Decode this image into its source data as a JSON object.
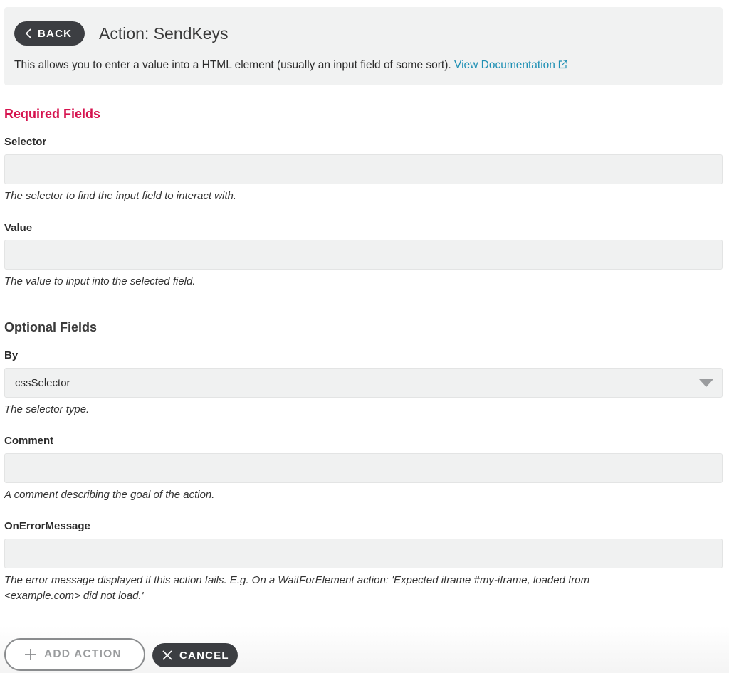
{
  "header": {
    "back_label": "BACK",
    "title": "Action: SendKeys",
    "description": "This allows you to enter a value into a HTML element (usually an input field of some sort).",
    "doc_link": "View Documentation"
  },
  "required": {
    "section_title": "Required Fields",
    "selector": {
      "label": "Selector",
      "value": "",
      "help": "The selector to find the input field to interact with."
    },
    "value": {
      "label": "Value",
      "value": "",
      "help": "The value to input into the selected field."
    }
  },
  "optional": {
    "section_title": "Optional Fields",
    "by": {
      "label": "By",
      "selected": "cssSelector",
      "help": "The selector type."
    },
    "comment": {
      "label": "Comment",
      "value": "",
      "help": "A comment describing the goal of the action."
    },
    "on_error": {
      "label": "OnErrorMessage",
      "value": "",
      "help_line1": "The error message displayed if this action fails. E.g. On a WaitForElement action: 'Expected iframe #my-iframe, loaded from",
      "help_line2": "<example.com> did not load.'"
    }
  },
  "footer": {
    "add_label": "ADD ACTION",
    "cancel_label": "CANCEL"
  },
  "colors": {
    "accent_required": "#d6134f",
    "link": "#1f90b4",
    "dark_button": "#3c3e42",
    "field_bg": "#f0f1f1"
  },
  "icons": {
    "back": "chevron-left-icon",
    "external": "external-link-icon",
    "dropdown": "caret-down-icon",
    "add": "plus-icon",
    "cancel": "close-icon"
  }
}
